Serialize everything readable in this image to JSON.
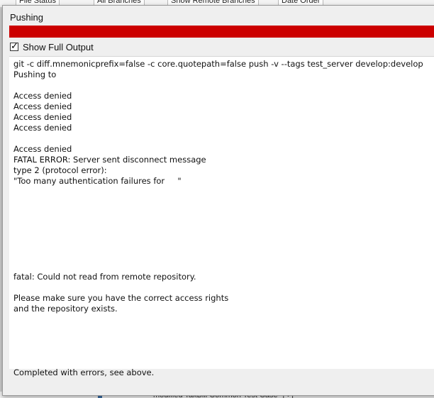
{
  "background": {
    "toolbar_items": [
      "File Status",
      "All Branches",
      "Show Remote Branches",
      "Date Order"
    ],
    "bottom_text": "modified   TaxBill  Common Test Case 추가"
  },
  "dialog": {
    "title": "Pushing",
    "progress_color": "#cc0000",
    "progress_value": 1.0,
    "show_full_output_label": "Show Full Output",
    "show_full_output_checked": true,
    "output_lines": [
      "git -c diff.mnemonicprefix=false -c core.quotepath=false push -v --tags test_server develop:develop",
      "Pushing to",
      "",
      "Access denied",
      "Access denied",
      "Access denied",
      "Access denied",
      "",
      "Access denied",
      "FATAL ERROR: Server sent disconnect message",
      "type 2 (protocol error):",
      "\"Too many authentication failures for     \"",
      "",
      "",
      "",
      "",
      "",
      "",
      "",
      "",
      "fatal: Could not read from remote repository.",
      "",
      "Please make sure you have the correct access rights",
      "and the repository exists.",
      "",
      "",
      "",
      "",
      "",
      "Completed with errors, see above."
    ]
  }
}
